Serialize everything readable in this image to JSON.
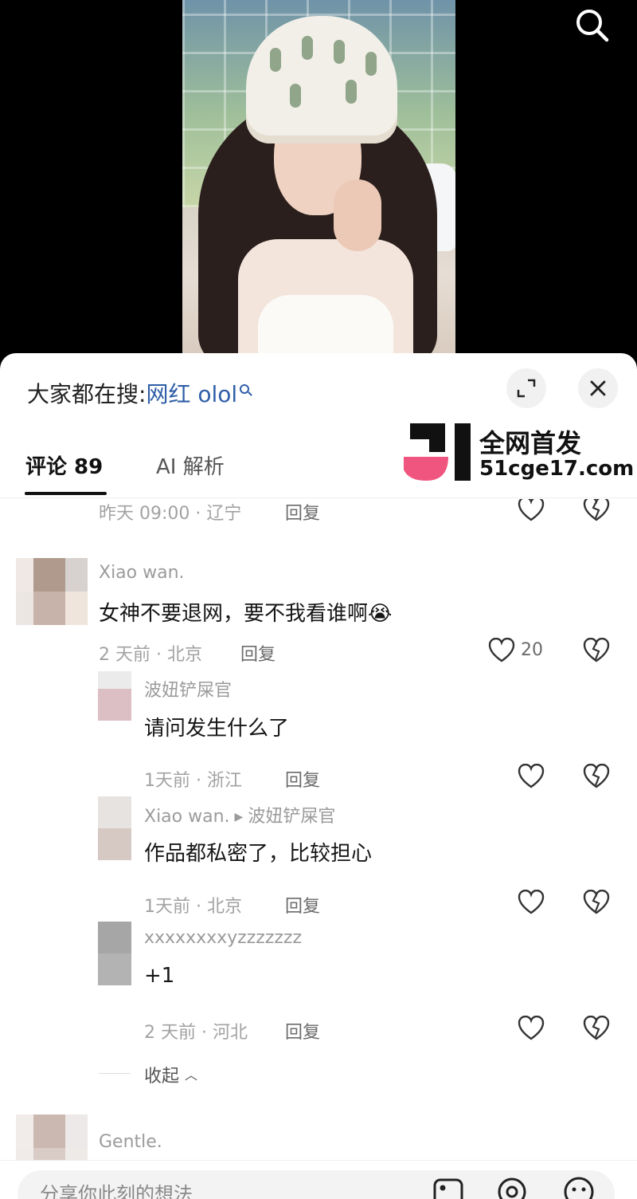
{
  "video": {
    "search_icon": "search-icon"
  },
  "sheet": {
    "trending_label": "大家都在搜:",
    "trending_term": "网红 olol",
    "tabs": [
      {
        "label": "评论 89"
      },
      {
        "label": "AI 解析"
      }
    ],
    "watermark": {
      "line1": "全网首发",
      "line2": "51cge17.com"
    }
  },
  "comments": [
    {
      "meta": "昨天 09:00 · 辽宁",
      "reply_label": "回复"
    },
    {
      "username": "Xiao wan.",
      "text": "女神不要退网，要不我看谁啊",
      "emoji": "😭",
      "meta": "2 天前 · 北京",
      "reply_label": "回复",
      "likes": "20",
      "replies": [
        {
          "username": "波妞铲屎官",
          "text": "请问发生什么了",
          "meta": "1天前 · 浙江",
          "reply_label": "回复"
        },
        {
          "username": "Xiao wan.",
          "reply_to": "波妞铲屎官",
          "text": "作品都私密了，比较担心",
          "meta": "1天前 · 北京",
          "reply_label": "回复"
        },
        {
          "username": "xxxxxxxxyzzzzzzz",
          "text": "+1",
          "meta": "2 天前 · 河北",
          "reply_label": "回复"
        }
      ],
      "collapse_label": "收起"
    },
    {
      "username": "Gentle."
    }
  ],
  "input": {
    "placeholder": "分享你此刻的想法"
  },
  "colors": {
    "link": "#2f5ea8",
    "muted": "#a2a2a2",
    "watermark_pink": "#f0557f"
  }
}
